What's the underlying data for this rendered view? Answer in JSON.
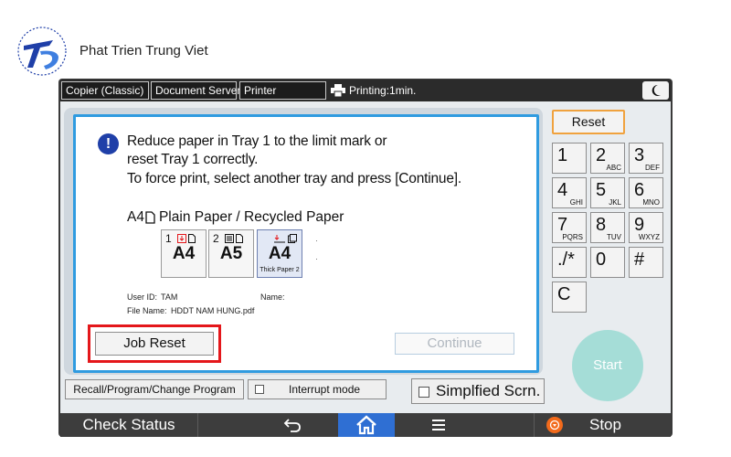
{
  "brand": {
    "name": "Phat Trien Trung Viet"
  },
  "topbar": {
    "tabs": [
      "Copier (Classic)",
      "Document Server",
      "Printer"
    ],
    "printing_status": "Printing:1min."
  },
  "dialog": {
    "message": [
      "Reduce paper in Tray 1 to the limit mark or",
      "reset Tray 1 correctly.",
      "To force print, select another tray and press [Continue]."
    ],
    "paper_size": "A4",
    "paper_type": "Plain Paper / Recycled Paper",
    "trays": [
      {
        "number": "1",
        "size": "A4",
        "sub": ""
      },
      {
        "number": "2",
        "size": "A5",
        "sub": ""
      },
      {
        "number": "",
        "size": "A4",
        "sub": "Thick Paper 2"
      }
    ],
    "user_id_label": "User ID:",
    "user_id_value": "TAM",
    "name_label": "Name:",
    "file_name_label": "File Name:",
    "file_name_value": "HDDT NAM HUNG.pdf",
    "job_reset_label": "Job Reset",
    "continue_label": "Continue"
  },
  "bottom_controls": {
    "recall_label": "Recall/Program/Change Program",
    "interrupt_label": "Interrupt mode",
    "simplified_label": "Simplfied Scrn."
  },
  "keypad": {
    "reset_label": "Reset",
    "keys": [
      {
        "digit": "1",
        "letters": ""
      },
      {
        "digit": "2",
        "letters": "ABC"
      },
      {
        "digit": "3",
        "letters": "DEF"
      },
      {
        "digit": "4",
        "letters": "GHI"
      },
      {
        "digit": "5",
        "letters": "JKL"
      },
      {
        "digit": "6",
        "letters": "MNO"
      },
      {
        "digit": "7",
        "letters": "PQRS"
      },
      {
        "digit": "8",
        "letters": "TUV"
      },
      {
        "digit": "9",
        "letters": "WXYZ"
      },
      {
        "digit": "./*",
        "letters": ""
      },
      {
        "digit": "0",
        "letters": ""
      },
      {
        "digit": "#",
        "letters": ""
      },
      {
        "digit": "C",
        "letters": ""
      }
    ],
    "start_label": "Start"
  },
  "bottombar": {
    "check_status_label": "Check Status",
    "stop_label": "Stop"
  },
  "colors": {
    "dialog_border": "#2f9be0",
    "highlight": "#e4171b",
    "reset_border": "#f0a23e",
    "start": "#a5ddd7",
    "home": "#2f6fd3",
    "stop_icon": "#f26a1b"
  },
  "icons": [
    "brand-logo",
    "printer-icon",
    "moon-icon",
    "alert-icon",
    "paper-portrait-icon",
    "back-arrow-icon",
    "home-icon",
    "menu-icon",
    "stop-icon"
  ]
}
